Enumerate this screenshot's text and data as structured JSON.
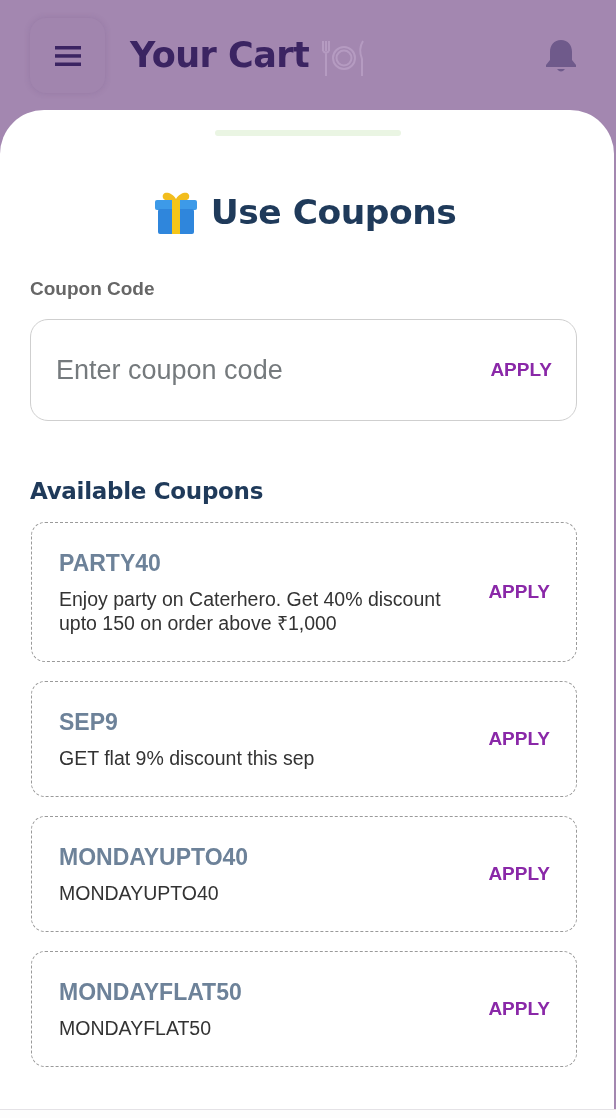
{
  "header": {
    "title": "Your Cart"
  },
  "sheet": {
    "title": "Use Coupons",
    "coupon_field": {
      "label": "Coupon Code",
      "placeholder": "Enter coupon code",
      "apply_label": "APPLY"
    },
    "available_title": "Available Coupons",
    "coupons": [
      {
        "code": "PARTY40",
        "description": "Enjoy party on Caterhero. Get 40% discount upto 150 on order above ₹1,000",
        "apply_label": "APPLY"
      },
      {
        "code": "SEP9",
        "description": "GET flat 9% discount this sep",
        "apply_label": "APPLY"
      },
      {
        "code": "MONDAYUPTO40",
        "description": "MONDAYUPTO40",
        "apply_label": "APPLY"
      },
      {
        "code": "MONDAYFLAT50",
        "description": "MONDAYFLAT50",
        "apply_label": "APPLY"
      }
    ]
  }
}
